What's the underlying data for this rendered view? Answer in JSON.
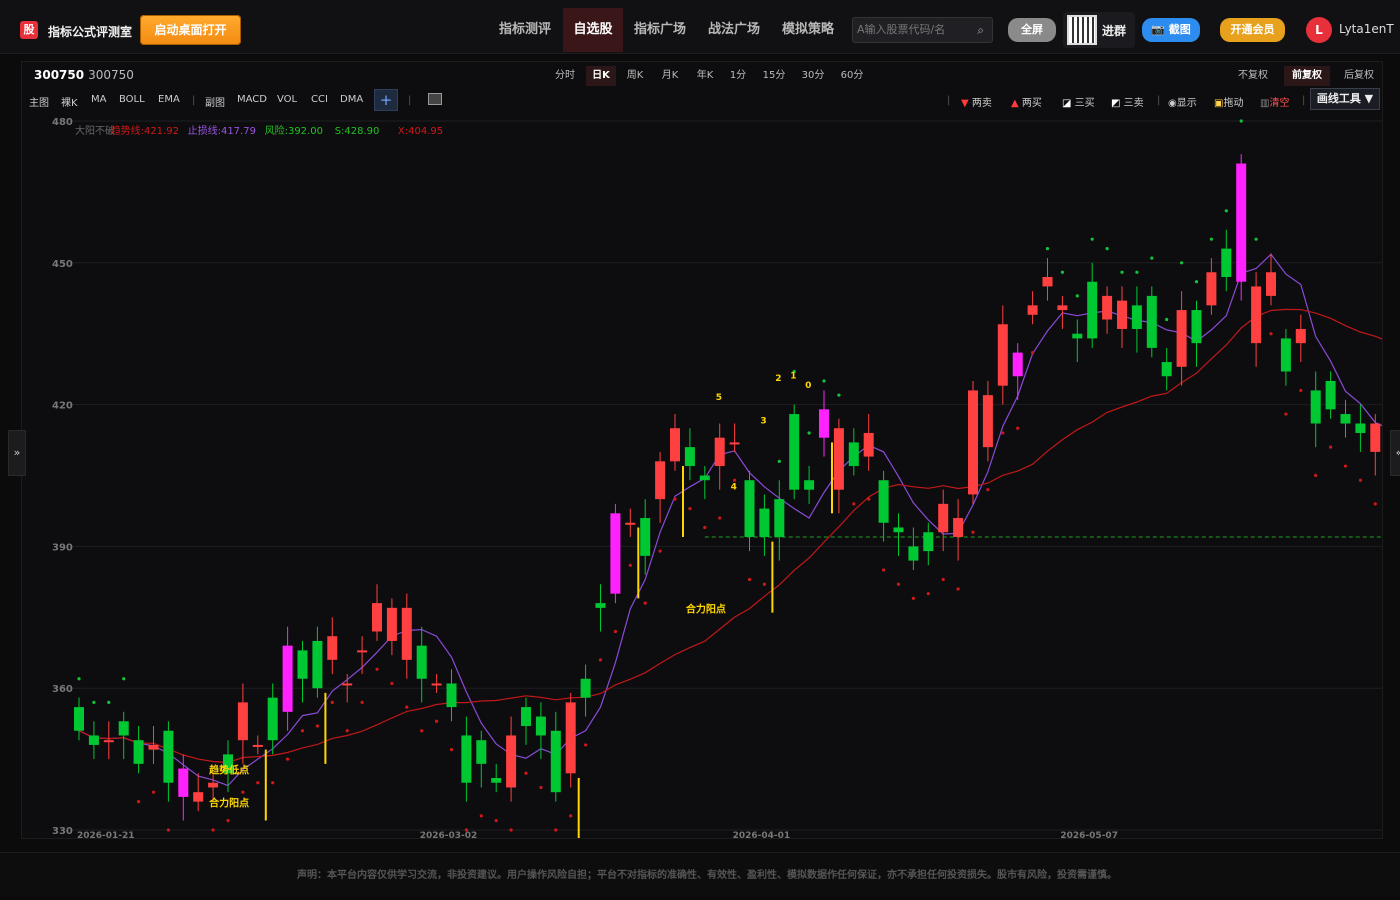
{
  "topbar": {
    "logo_char": "股",
    "app_title": "指标公式评测室",
    "desktop_button": "启动桌面打开",
    "nav": [
      "指标测评",
      "自选股",
      "指标广场",
      "战法广场",
      "模拟策略"
    ],
    "search_placeholder": "A输入股票代码/名",
    "fullscreen": "全屏",
    "join_group": "进群",
    "screenshot": "截图",
    "vip": "开通会员",
    "avatar_letter": "L",
    "username": "Lyta1enT"
  },
  "stock": {
    "code": "300750",
    "name": "300750"
  },
  "periods": [
    "分时",
    "日K",
    "周K",
    "月K",
    "年K",
    "1分",
    "15分",
    "30分",
    "60分"
  ],
  "adjust": [
    "不复权",
    "前复权",
    "后复权"
  ],
  "indicators_main": [
    "主图",
    "裸K",
    "MA",
    "BOLL",
    "EMA"
  ],
  "indicators_sub": [
    "副图",
    "MACD",
    "VOL",
    "CCI",
    "DMA"
  ],
  "tools": [
    "两卖",
    "两买",
    "三买",
    "三卖",
    "显示",
    "拖动",
    "清空"
  ],
  "draw_tools": "画线工具 ▼",
  "colors": {
    "up": "#ff4040",
    "down": "#00c832",
    "strong_up": "#ff22ff",
    "ma_short": "#8a4bd6",
    "ma_long": "#c01818",
    "signal": "#ffd700"
  },
  "chart_data": {
    "type": "candlestick",
    "ylim": [
      330,
      480
    ],
    "y_ticks": [
      480,
      450,
      420,
      390,
      360,
      330
    ],
    "x_ticks": [
      "2026-01-21",
      "2026-03-02",
      "2026-04-01",
      "2026-05-07"
    ],
    "indicator_line": {
      "name": "大阳不破",
      "trend": "趋势线:421.92",
      "stop": "止损线:417.79",
      "risk": "风险:392.00",
      "s": "S:428.90",
      "x": "X:404.95"
    },
    "support_level": 392,
    "candles": [
      [
        356,
        351
      ],
      [
        350,
        348
      ],
      [
        349,
        349
      ],
      [
        353,
        350
      ],
      [
        349,
        344
      ],
      [
        347,
        348
      ],
      [
        351,
        340
      ],
      [
        343,
        337
      ],
      [
        336,
        338
      ],
      [
        339,
        340
      ],
      [
        346,
        342
      ],
      [
        349,
        357
      ],
      [
        348,
        348
      ],
      [
        358,
        349
      ],
      [
        369,
        355
      ],
      [
        368,
        362
      ],
      [
        370,
        360
      ],
      [
        366,
        371
      ],
      [
        361,
        361
      ],
      [
        368,
        368
      ],
      [
        372,
        378
      ],
      [
        370,
        377
      ],
      [
        366,
        377
      ],
      [
        369,
        362
      ],
      [
        361,
        361
      ],
      [
        361,
        356
      ],
      [
        350,
        340
      ],
      [
        349,
        344
      ],
      [
        341,
        340
      ],
      [
        339,
        350
      ],
      [
        356,
        352
      ],
      [
        354,
        350
      ],
      [
        351,
        338
      ],
      [
        342,
        357
      ],
      [
        362,
        358
      ],
      [
        378,
        377
      ],
      [
        380,
        397
      ],
      [
        395,
        395
      ],
      [
        396,
        388
      ],
      [
        400,
        408
      ],
      [
        408,
        415
      ],
      [
        411,
        407
      ],
      [
        405,
        404
      ],
      [
        407,
        413
      ],
      [
        412,
        412
      ],
      [
        404,
        392
      ],
      [
        398,
        392
      ],
      [
        400,
        392
      ],
      [
        418,
        402
      ],
      [
        404,
        402
      ],
      [
        413,
        419
      ],
      [
        402,
        415
      ],
      [
        412,
        407
      ],
      [
        409,
        414
      ],
      [
        404,
        395
      ],
      [
        394,
        393
      ],
      [
        390,
        387
      ],
      [
        393,
        389
      ],
      [
        393,
        399
      ],
      [
        392,
        396
      ],
      [
        401,
        423
      ],
      [
        411,
        422
      ],
      [
        424,
        437
      ],
      [
        426,
        431
      ],
      [
        439,
        441
      ],
      [
        445,
        447
      ],
      [
        440,
        441
      ],
      [
        435,
        434
      ],
      [
        446,
        434
      ],
      [
        438,
        443
      ],
      [
        436,
        442
      ],
      [
        441,
        436
      ],
      [
        443,
        432
      ],
      [
        429,
        426
      ],
      [
        428,
        440
      ],
      [
        440,
        433
      ],
      [
        441,
        448
      ],
      [
        453,
        447
      ],
      [
        446,
        471
      ],
      [
        433,
        445
      ],
      [
        443,
        448
      ],
      [
        434,
        427
      ],
      [
        433,
        436
      ],
      [
        423,
        416
      ],
      [
        425,
        419
      ],
      [
        418,
        416
      ],
      [
        416,
        414
      ],
      [
        410,
        416
      ],
      [
        418,
        409
      ],
      [
        413,
        410
      ],
      [
        405,
        399
      ],
      [
        407,
        403
      ],
      [
        409,
        414
      ],
      [
        418,
        417
      ],
      [
        418,
        429
      ],
      [
        426,
        429
      ],
      [
        435,
        428
      ],
      [
        434,
        435
      ]
    ],
    "pink_candles": [
      7,
      14,
      36,
      50,
      63,
      78,
      95
    ],
    "signals": [
      {
        "label": "趋势低点",
        "x_index": 9,
        "y": 342
      },
      {
        "label": "合力阳点",
        "x_index": 9,
        "y": 335
      },
      {
        "label": "合力阳点",
        "x_index": 41,
        "y": 376
      },
      {
        "label": "5",
        "x_index": 43,
        "y": 421
      },
      {
        "label": "4",
        "x_index": 44,
        "y": 402
      },
      {
        "label": "3",
        "x_index": 46,
        "y": 416
      },
      {
        "label": "2",
        "x_index": 47,
        "y": 425
      },
      {
        "label": "1",
        "x_index": 48,
        "y": 425.5
      },
      {
        "label": "0",
        "x_index": 49,
        "y": 423.5
      }
    ]
  },
  "disclaimer": "声明：本平台内容仅供学习交流，非投资建议。用户操作风险自担；平台不对指标的准确性、有效性、盈利性、模拟数据作任何保证，亦不承担任何投资损失。股市有风险，投资需谨慎。"
}
